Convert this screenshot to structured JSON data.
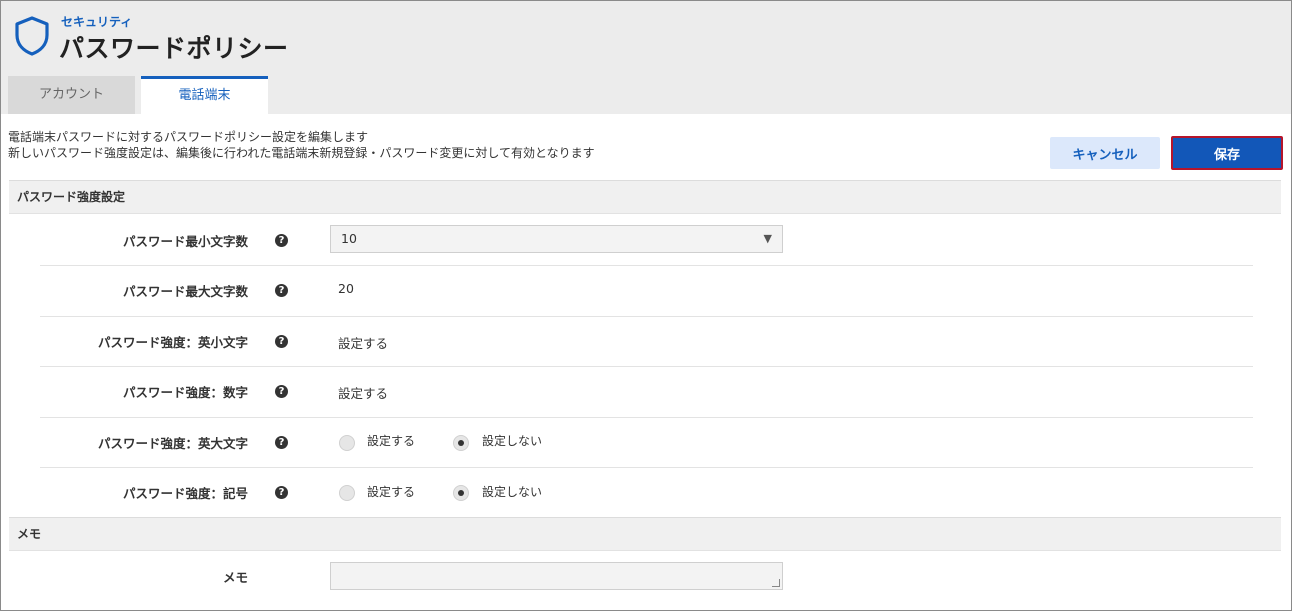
{
  "header": {
    "subtitle": "セキュリティ",
    "title": "パスワードポリシー",
    "icon": "shield-icon"
  },
  "tabs": [
    {
      "label": "アカウント",
      "active": false
    },
    {
      "label": "電話端末",
      "active": true
    }
  ],
  "description": {
    "line1": "電話端末パスワードに対するパスワードポリシー設定を編集します",
    "line2": "新しいパスワード強度設定は、編集後に行われた電話端末新規登録・パスワード変更に対して有効となります"
  },
  "actions": {
    "cancel_label": "キャンセル",
    "save_label": "保存"
  },
  "password_section": {
    "title": "パスワード強度設定",
    "min_length": {
      "label": "パスワード最小文字数",
      "value": "10"
    },
    "max_length": {
      "label": "パスワード最大文字数",
      "value": "20"
    },
    "lowercase": {
      "label": "パスワード強度：英小文字",
      "value": "設定する"
    },
    "digits": {
      "label": "パスワード強度：数字",
      "value": "設定する"
    },
    "uppercase": {
      "label": "パスワード強度：英大文字",
      "option_on": "設定する",
      "option_off": "設定しない",
      "selected": "設定しない"
    },
    "symbols": {
      "label": "パスワード強度：記号",
      "option_on": "設定する",
      "option_off": "設定しない",
      "selected": "設定しない"
    }
  },
  "memo_section": {
    "title": "メモ",
    "label": "メモ",
    "value": ""
  },
  "colors": {
    "accent": "#1560bd",
    "save_bg": "#1257b8",
    "save_border": "#b5152b",
    "cancel_bg": "#dce8fb"
  }
}
